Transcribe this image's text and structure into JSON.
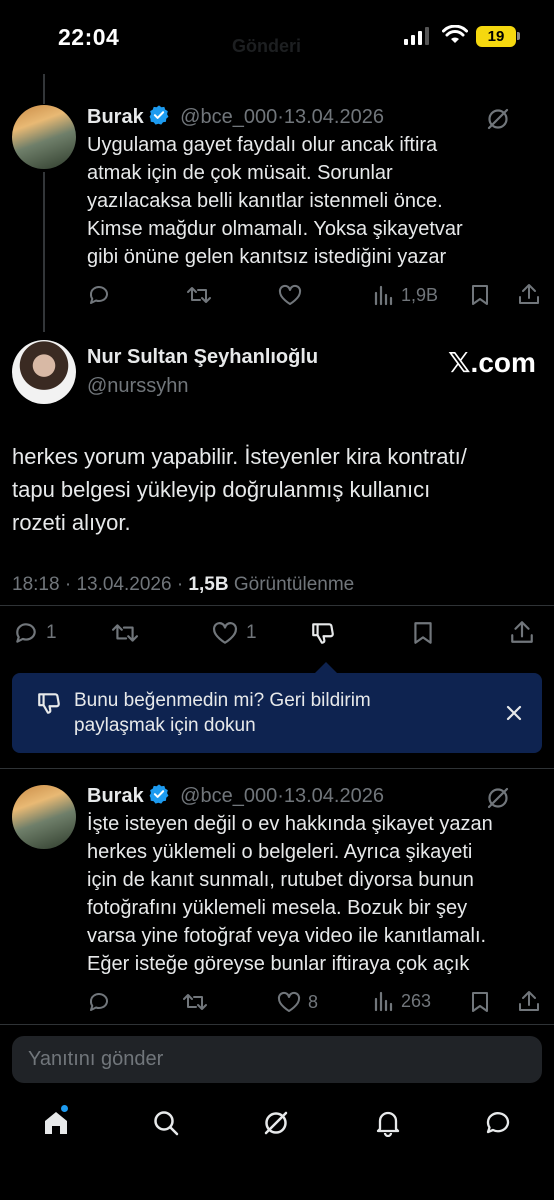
{
  "status_bar": {
    "time": "22:04",
    "battery": "19",
    "ghost_title": "Gönderi"
  },
  "reply_top": {
    "name": "Burak",
    "handle": "@bce_000",
    "sep": "·",
    "date": "13.04.2026",
    "lines": [
      "Uygulama gayet faydalı olur ancak iftira",
      "atmak için de çok müsait. Sorunlar",
      "yazılacaksa belli kanıtlar istenmeli önce.",
      "Kimse mağdur olmamalı. Yoksa şikayetvar",
      "gibi önüne gelen kanıtsız istediğini yazar"
    ],
    "views": "1,9B"
  },
  "main_tweet": {
    "name": "Nur Sultan Şeyhanlıoğlu",
    "handle": "@nurssyhn",
    "source": "𝕏.com",
    "lines": [
      "herkes yorum yapabilir. İsteyenler kira kontratı/",
      "tapu belgesi yükleyip doğrulanmış kullanıcı",
      "rozeti alıyor."
    ],
    "time": "18:18",
    "sep": "·",
    "date": "13.04.2026",
    "views_count": "1,5B",
    "views_label": "Görüntülenme",
    "replies": "1",
    "likes": "1"
  },
  "feedback": {
    "lines": [
      "Bunu beğenmedin mi? Geri bildirim",
      "paylaşmak için dokun"
    ]
  },
  "reply_bottom": {
    "name": "Burak",
    "handle": "@bce_000",
    "sep": "·",
    "date": "13.04.2026",
    "lines": [
      "İşte isteyen değil o ev hakkında şikayet yazan",
      "herkes yüklemeli o belgeleri. Ayrıca şikayeti",
      "için de kanıt sunmalı, rutubet diyorsa bunun",
      "fotoğrafını yüklemeli mesela. Bozuk bir şey",
      "varsa yine fotoğraf veya video ile kanıtlamalı.",
      "Eğer isteğe göreyse bunlar iftiraya çok açık"
    ],
    "likes": "8",
    "views": "263"
  },
  "composer": {
    "placeholder": "Yanıtını gönder"
  },
  "colors": {
    "accent": "#1d9bf0",
    "muted": "#71767b",
    "feedback_bg": "#0e2350",
    "battery": "#f5d80f"
  },
  "icons": [
    "home-icon",
    "search-icon",
    "grok-icon",
    "bell-icon",
    "messages-icon",
    "reply-icon",
    "retweet-icon",
    "like-icon",
    "views-icon",
    "bookmark-icon",
    "share-icon",
    "dislike-icon",
    "close-icon",
    "verified-icon"
  ]
}
